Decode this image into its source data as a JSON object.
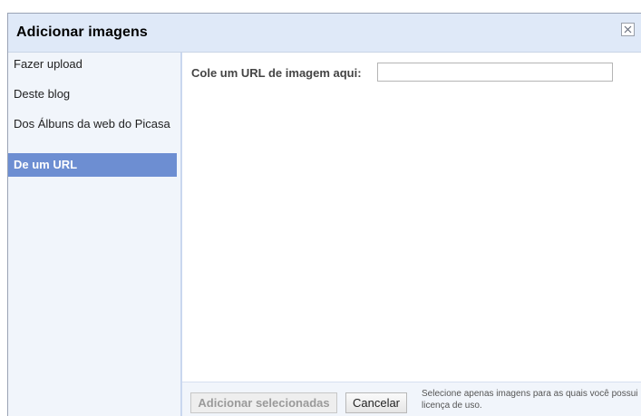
{
  "dialog": {
    "title": "Adicionar imagens",
    "close_icon": "close-icon"
  },
  "sidebar": {
    "items": [
      {
        "label": "Fazer upload",
        "selected": false
      },
      {
        "label": "Deste blog",
        "selected": false
      },
      {
        "label": "Dos Álbuns da web do Picasa",
        "selected": false
      },
      {
        "label": "De um URL",
        "selected": true
      }
    ]
  },
  "content": {
    "url_label": "Cole um URL de imagem aqui:",
    "url_value": "",
    "url_placeholder": ""
  },
  "footer": {
    "add_label": "Adicionar selecionadas",
    "cancel_label": "Cancelar",
    "note": "Selecione apenas imagens para as quais você possui licença de uso."
  },
  "colors": {
    "titlebar_bg": "#dfe9f8",
    "sidebar_bg": "#f1f5fb",
    "selected_item_bg": "#6d8ed2"
  }
}
